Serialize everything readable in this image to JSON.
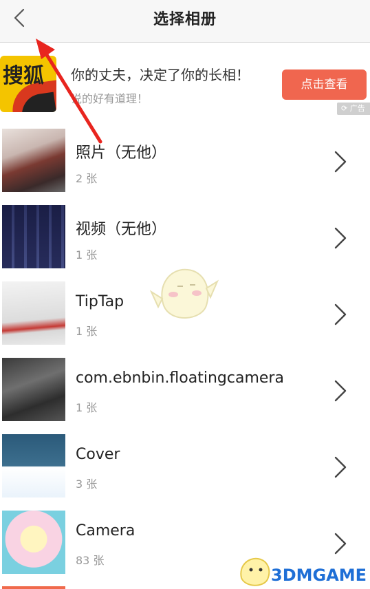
{
  "header": {
    "title": "选择相册"
  },
  "ad": {
    "logo_text": "搜狐",
    "headline": "你的丈夫，决定了你的长相！",
    "subtext": "说的好有道理！",
    "cta_label": "点击查看",
    "badge": "广告"
  },
  "albums": [
    {
      "name": "照片（无他）",
      "count": "2 张"
    },
    {
      "name": "视频（无他）",
      "count": "1 张"
    },
    {
      "name": "TipTap",
      "count": "1 张"
    },
    {
      "name": "com.ebnbin.floatingcamera",
      "count": "1 张"
    },
    {
      "name": "Cover",
      "count": "3 张"
    },
    {
      "name": "Camera",
      "count": "83 张"
    }
  ],
  "watermark": "3DMGAME",
  "colors": {
    "cta": "#f0664f",
    "annotation_arrow": "#e8251f",
    "logo_bg": "#f4c400"
  }
}
